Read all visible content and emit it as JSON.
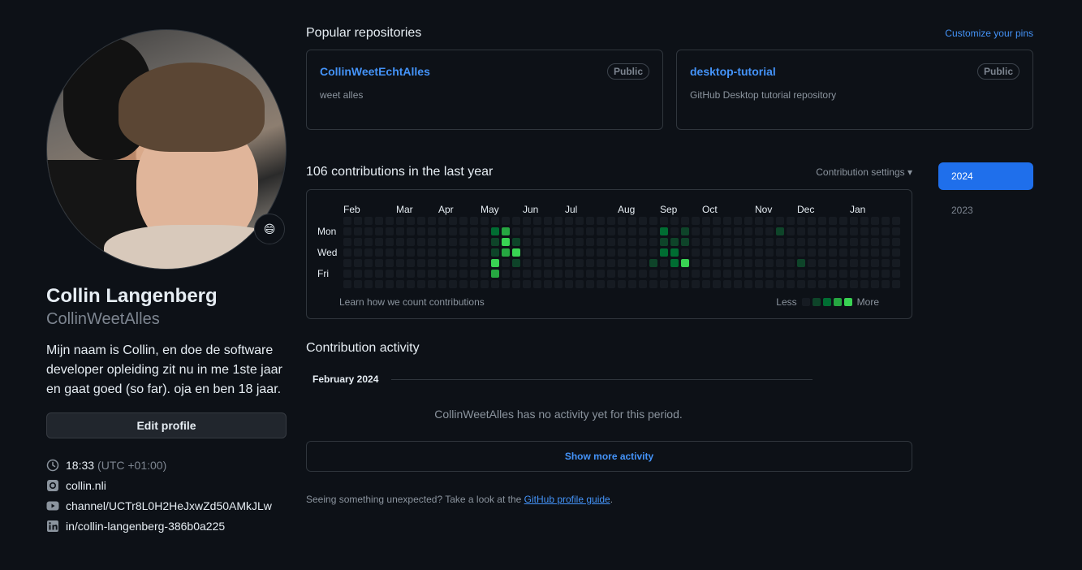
{
  "profile": {
    "name": "Collin Langenberg",
    "username": "CollinWeetAlles",
    "bio": "Mijn naam is Collin, en doe de software developer opleiding zit nu in me 1ste jaar en gaat goed (so far). oja en ben 18 jaar.",
    "edit_label": "Edit profile",
    "status_emoji": "😄",
    "time": "18:33",
    "timezone": "(UTC +01:00)",
    "website": "collin.nli",
    "youtube": "channel/UCTr8L0H2HeJxwZd50AMkJLw",
    "linkedin": "in/collin-langenberg-386b0a225"
  },
  "pins": {
    "title": "Popular repositories",
    "customize": "Customize your pins",
    "items": [
      {
        "name": "CollinWeetEchtAlles",
        "visibility": "Public",
        "description": "weet alles"
      },
      {
        "name": "desktop-tutorial",
        "visibility": "Public",
        "description": "GitHub Desktop tutorial repository"
      }
    ]
  },
  "contributions": {
    "title": "106 contributions in the last year",
    "settings": "Contribution settings ▾",
    "learn": "Learn how we count contributions",
    "less": "Less",
    "more": "More",
    "months": [
      "Feb",
      "Mar",
      "Apr",
      "May",
      "Jun",
      "Jul",
      "Aug",
      "Sep",
      "Oct",
      "Nov",
      "Dec",
      "Jan"
    ],
    "days": [
      "Mon",
      "Wed",
      "Fri"
    ],
    "weeks": 53,
    "month_weeks": [
      0,
      5,
      9,
      13,
      17,
      21,
      26,
      30,
      34,
      39,
      43,
      48
    ],
    "cells": [
      [
        14,
        1,
        2
      ],
      [
        14,
        2,
        1
      ],
      [
        14,
        3,
        1
      ],
      [
        14,
        4,
        4
      ],
      [
        14,
        5,
        3
      ],
      [
        15,
        1,
        3
      ],
      [
        15,
        2,
        4
      ],
      [
        15,
        3,
        3
      ],
      [
        16,
        2,
        1
      ],
      [
        16,
        3,
        4
      ],
      [
        16,
        4,
        1
      ],
      [
        29,
        4,
        1
      ],
      [
        30,
        1,
        2
      ],
      [
        30,
        2,
        1
      ],
      [
        30,
        3,
        2
      ],
      [
        31,
        2,
        1
      ],
      [
        31,
        3,
        2
      ],
      [
        31,
        4,
        2
      ],
      [
        32,
        1,
        1
      ],
      [
        32,
        2,
        1
      ],
      [
        32,
        4,
        4
      ],
      [
        41,
        1,
        1
      ],
      [
        43,
        4,
        1
      ]
    ],
    "level_colors": [
      "#161b22",
      "#0e4429",
      "#006d32",
      "#26a641",
      "#39d353"
    ]
  },
  "years": [
    "2024",
    "2023"
  ],
  "activity": {
    "title": "Contribution activity",
    "month": "February 2024",
    "empty": "CollinWeetAlles has no activity yet for this period.",
    "show_more": "Show more activity",
    "unexpected_prefix": "Seeing something unexpected? Take a look at the ",
    "guide_link": "GitHub profile guide",
    "unexpected_suffix": "."
  }
}
